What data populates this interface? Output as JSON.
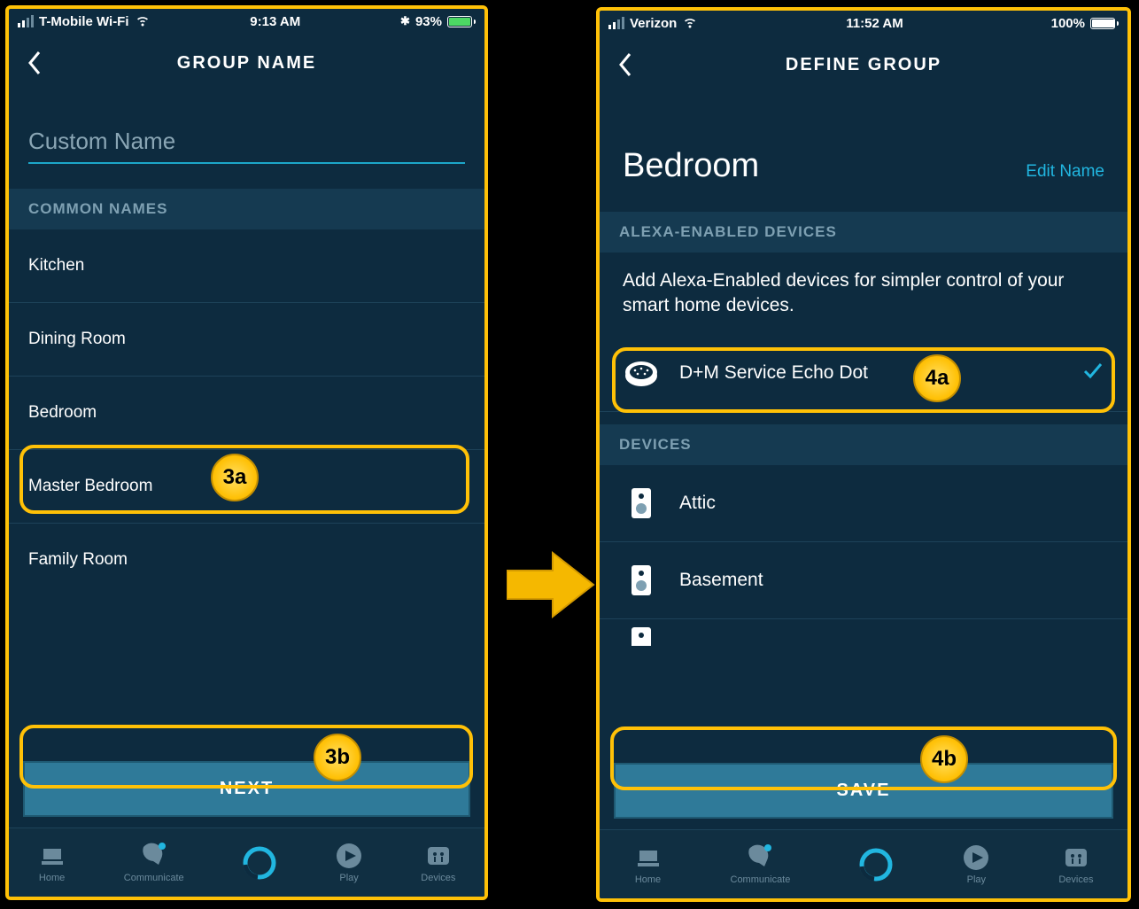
{
  "annotations": {
    "a3a": "3a",
    "a3b": "3b",
    "a4a": "4a",
    "a4b": "4b"
  },
  "colors": {
    "accent": "#ffc107",
    "link": "#21b6e0",
    "button_bg": "#2f7a99",
    "battery_green": "#4cd964"
  },
  "left_phone": {
    "status": {
      "carrier": "T-Mobile Wi-Fi",
      "time": "9:13 AM",
      "bluetooth": "✱",
      "battery_pct": "93%"
    },
    "header_title": "GROUP NAME",
    "custom_name_placeholder": "Custom Name",
    "section_label": "COMMON NAMES",
    "common_names": [
      "Kitchen",
      "Dining Room",
      "Bedroom",
      "Master Bedroom",
      "Family Room"
    ],
    "next_button": "NEXT",
    "tabs": [
      "Home",
      "Communicate",
      "",
      "Play",
      "Devices"
    ]
  },
  "right_phone": {
    "status": {
      "carrier": "Verizon",
      "time": "11:52 AM",
      "battery_pct": "100%"
    },
    "header_title": "DEFINE GROUP",
    "group_name": "Bedroom",
    "edit_name": "Edit Name",
    "section_alexa": "ALEXA-ENABLED DEVICES",
    "alexa_help": "Add Alexa-Enabled devices for simpler control of your smart home devices.",
    "alexa_device": "D+M Service Echo Dot",
    "section_devices": "DEVICES",
    "devices": [
      "Attic",
      "Basement"
    ],
    "save_button": "SAVE",
    "tabs": [
      "Home",
      "Communicate",
      "",
      "Play",
      "Devices"
    ]
  }
}
